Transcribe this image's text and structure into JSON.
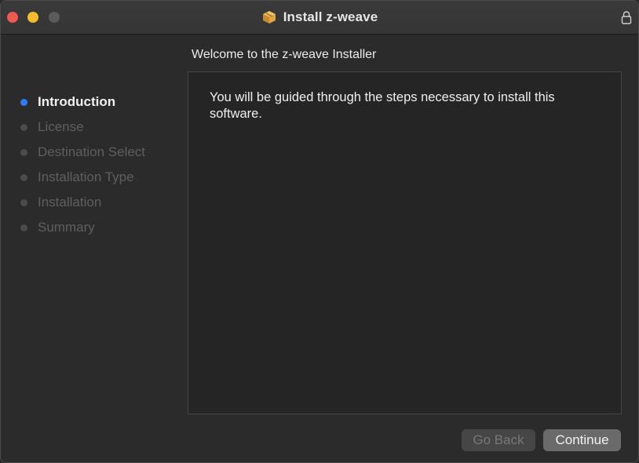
{
  "window": {
    "title": "Install z-weave"
  },
  "header": {
    "text": "Welcome to the z-weave Installer"
  },
  "sidebar": {
    "steps": [
      {
        "label": "Introduction",
        "active": true
      },
      {
        "label": "License",
        "active": false
      },
      {
        "label": "Destination Select",
        "active": false
      },
      {
        "label": "Installation Type",
        "active": false
      },
      {
        "label": "Installation",
        "active": false
      },
      {
        "label": "Summary",
        "active": false
      }
    ]
  },
  "content": {
    "body": "You will be guided through the steps necessary to install this software."
  },
  "buttons": {
    "back_label": "Go Back",
    "continue_label": "Continue"
  },
  "icons": {
    "title": "package-icon",
    "lock": "lock-icon"
  },
  "colors": {
    "accent": "#2f7bf6",
    "close": "#ee5a52",
    "minimize": "#f3bb2d"
  }
}
